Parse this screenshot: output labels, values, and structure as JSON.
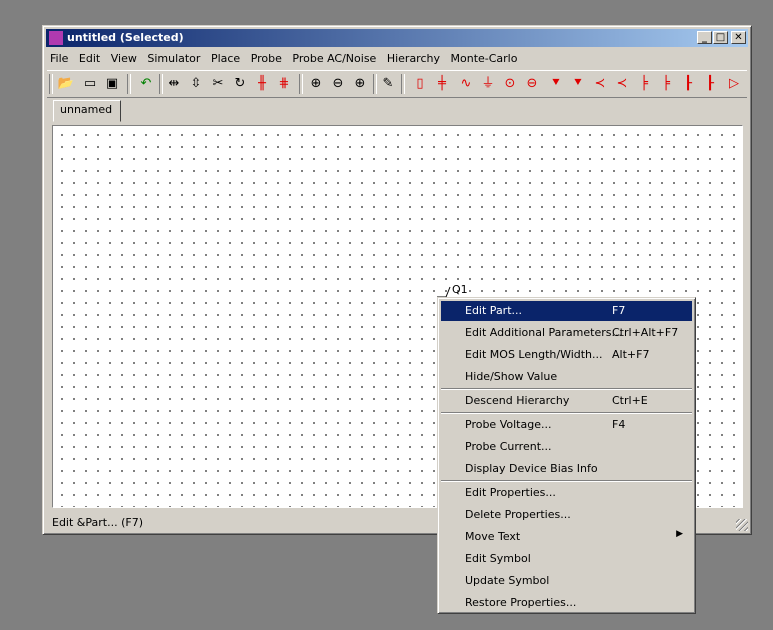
{
  "window": {
    "title": "untitled (Selected)",
    "controls": {
      "minimize": "_",
      "maximize": "□",
      "close": "✕"
    }
  },
  "menubar": [
    "File",
    "Edit",
    "View",
    "Simulator",
    "Place",
    "Probe",
    "Probe AC/Noise",
    "Hierarchy",
    "Monte-Carlo"
  ],
  "toolbar": {
    "icons": [
      "open-icon",
      "new-icon",
      "save-icon",
      "undo-icon",
      "flip-h-icon",
      "flip-v-icon",
      "cut-icon",
      "rotate-icon",
      "delete-wire-icon",
      "delete-icon",
      "zoom-fit-icon",
      "zoom-out-icon",
      "zoom-in-icon",
      "pencil-icon",
      "resistor-icon",
      "capacitor-icon",
      "inductor-icon",
      "ground-icon",
      "voltage-source-icon",
      "current-source-icon",
      "diode-icon",
      "zener-icon",
      "npn-icon",
      "pnp-icon",
      "nmos-icon",
      "pmos-icon",
      "opamp-icon"
    ],
    "accent": "#e00000"
  },
  "tabs": [
    "unnamed"
  ],
  "canvas": {
    "component_label": "Q1"
  },
  "statusbar": {
    "text": "Edit &Part... (F7)"
  },
  "context_menu": {
    "items": [
      {
        "label": "Edit Part...",
        "shortcut": "F7"
      },
      {
        "label": "Edit Additional Parameters...",
        "shortcut": "Ctrl+Alt+F7"
      },
      {
        "label": "Edit MOS Length/Width...",
        "shortcut": "Alt+F7"
      },
      {
        "label": "Hide/Show Value",
        "shortcut": ""
      },
      {
        "label": "Descend Hierarchy",
        "shortcut": "Ctrl+E"
      },
      {
        "label": "Probe Voltage...",
        "shortcut": "F4"
      },
      {
        "label": "Probe Current...",
        "shortcut": ""
      },
      {
        "label": "Display Device Bias Info",
        "shortcut": ""
      },
      {
        "label": "Edit Properties...",
        "shortcut": ""
      },
      {
        "label": "Delete Properties...",
        "shortcut": ""
      },
      {
        "label": "Move Text",
        "shortcut": ""
      },
      {
        "label": "Edit Symbol",
        "shortcut": ""
      },
      {
        "label": "Update Symbol",
        "shortcut": ""
      },
      {
        "label": "Restore Properties...",
        "shortcut": ""
      }
    ],
    "highlight_color": "#0a246a"
  }
}
